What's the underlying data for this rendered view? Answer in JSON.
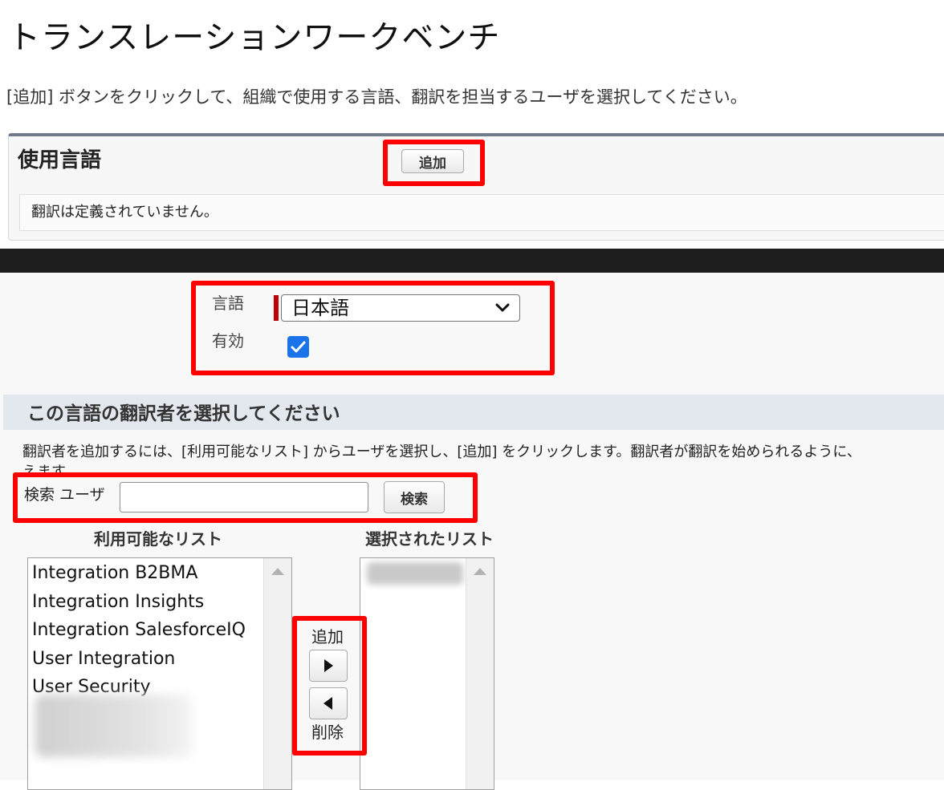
{
  "page": {
    "title": "トランスレーションワークベンチ",
    "description": "[追加] ボタンをクリックして、組織で使用する言語、翻訳を担当するユーザを選択してください。"
  },
  "languages_section": {
    "title": "使用言語",
    "add_label": "追加",
    "empty_message": "翻訳は定義されていません。"
  },
  "form": {
    "language_label": "言語",
    "language_value": "日本語",
    "active_label": "有効",
    "active_checked": true
  },
  "translators": {
    "heading": "この言語の翻訳者を選択してください",
    "instructions_line1": "翻訳者を追加するには、[利用可能なリスト] からユーザを選択し、[追加] をクリックします。翻訳者が翻訳を始められるように、",
    "instructions_line2": "えます",
    "search_label": "検索 ユーザ",
    "search_value": "",
    "search_button": "検索",
    "available_heading": "利用可能なリスト",
    "selected_heading": "選択されたリスト",
    "available_items": [
      "Integration B2BMA",
      "Integration Insights",
      "Integration SalesforceIQ",
      "User Integration",
      "User Security"
    ],
    "move_add_label": "追加",
    "move_remove_label": "削除"
  },
  "colors": {
    "highlight": "#ff0000",
    "checkbox": "#1a73e8",
    "required_bar": "#c00000",
    "section_head_bg": "#e3e8ef"
  },
  "icons": [
    "chevron-down-icon",
    "check-icon",
    "scroll-up-icon",
    "arrow-right-icon",
    "arrow-left-icon"
  ]
}
